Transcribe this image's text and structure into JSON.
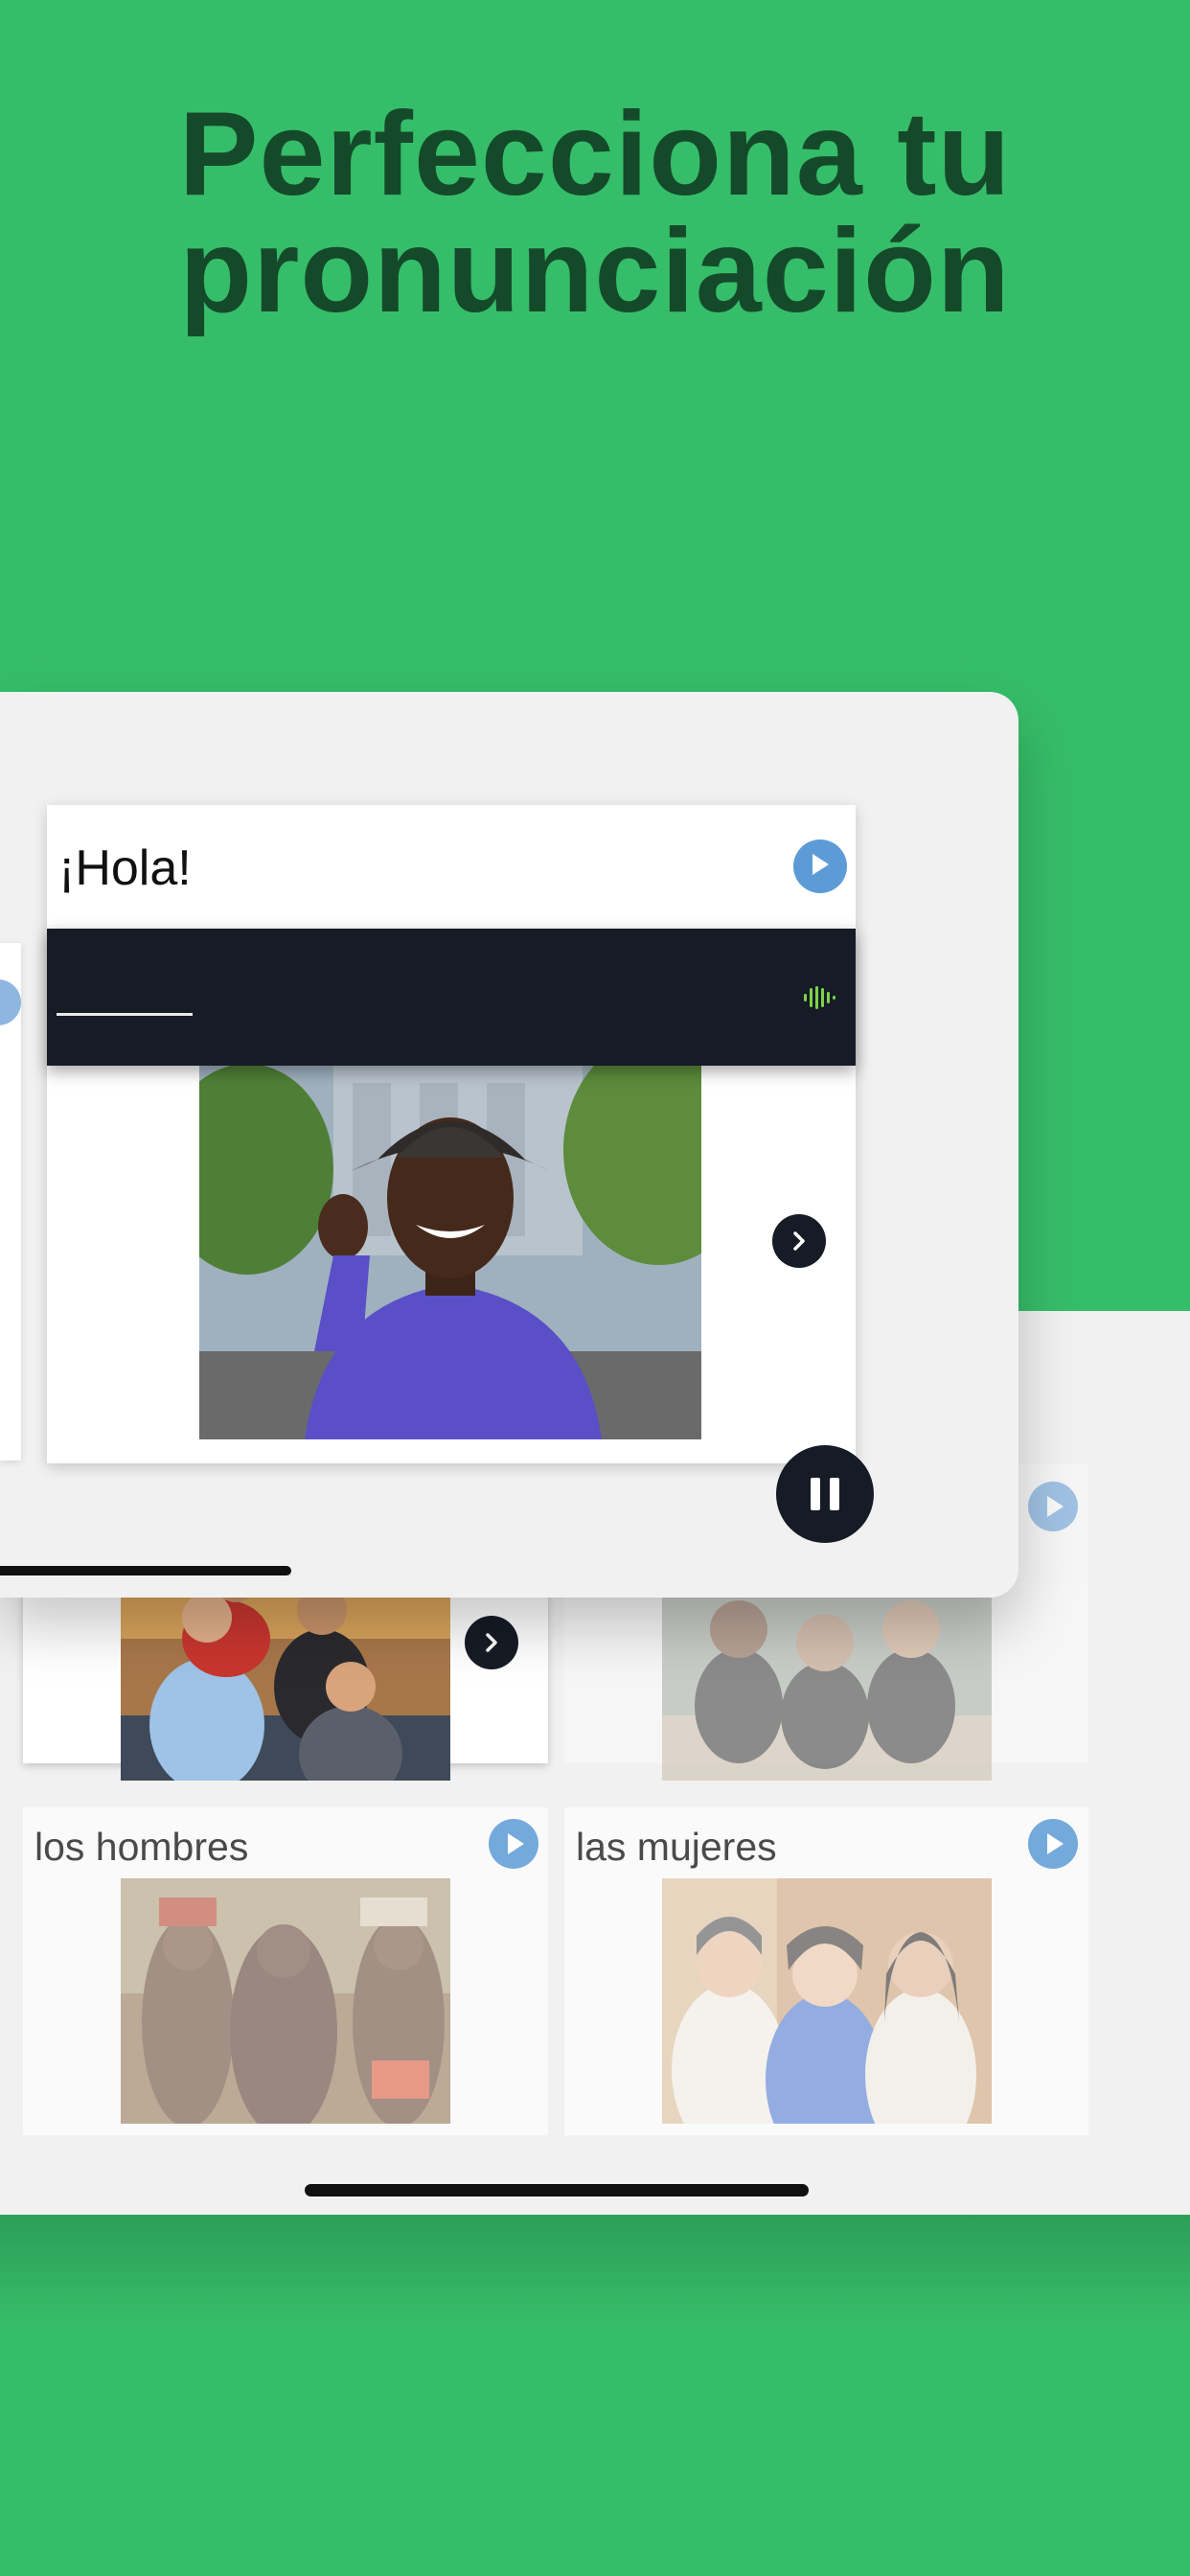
{
  "headline": {
    "line1": "Perfecciona tu",
    "line2": "pronunciación"
  },
  "lesson": {
    "phrase": "¡Hola!",
    "answer_value": ""
  },
  "vocab_tiles": [
    {
      "label": "",
      "faded": false
    },
    {
      "label": "",
      "faded": true
    },
    {
      "label": "los hombres",
      "faded": true
    },
    {
      "label": "las mujeres",
      "faded": true
    }
  ],
  "colors": {
    "background": "#36bd69",
    "headline": "#144a2a",
    "dark_bar": "#161b25",
    "play_button": "#5d9bd6",
    "wave_icon": "#7bd348"
  },
  "icons": {
    "play": "play-icon",
    "next": "chevron-right-icon",
    "pause": "pause-icon",
    "wave": "audio-wave-icon"
  }
}
